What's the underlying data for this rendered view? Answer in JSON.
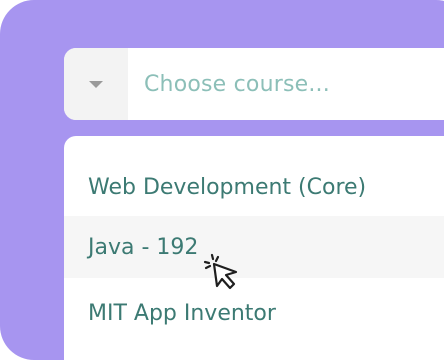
{
  "select": {
    "placeholder": "Choose course...",
    "toggle_icon": "chevron-down-icon"
  },
  "dropdown": {
    "options": [
      {
        "label": "Web Development (Core)",
        "hovered": false
      },
      {
        "label": "Java - 192",
        "hovered": true
      },
      {
        "label": "MIT App Inventor",
        "hovered": false
      }
    ]
  },
  "cursor": {
    "icon": "pointer-click-cursor-icon"
  },
  "colors": {
    "accent_purple": "#a795f0",
    "option_text": "#3c7a73",
    "placeholder_text": "#8cbfb8",
    "hover_bg": "#f6f6f6",
    "toggle_bg": "#f3f3f3"
  }
}
